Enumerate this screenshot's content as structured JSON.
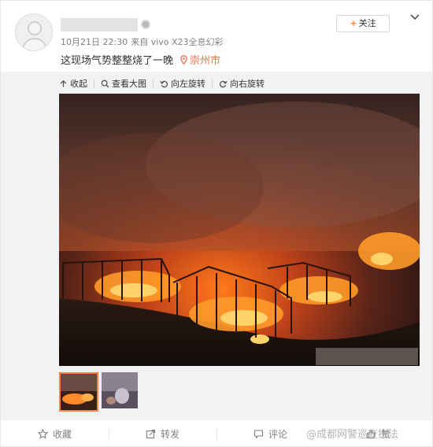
{
  "post": {
    "time": "10月21日 22:30",
    "source": "来自 vivo X23全息幻彩",
    "text": "这现场气势整整烧了一晚",
    "location": "崇州市",
    "follow_label": "关注",
    "follow_plus": "+"
  },
  "toolbar": {
    "collapse": "收起",
    "view_large": "查看大图",
    "rotate_left": "向左旋转",
    "rotate_right": "向右旋转"
  },
  "thumbnails": [
    {
      "label": "thumbnail-1",
      "active": true
    },
    {
      "label": "thumbnail-2",
      "active": false
    }
  ],
  "actions": {
    "favorite": "收藏",
    "repost": "转发",
    "comment": "评论",
    "like": "赞"
  },
  "watermark": "@成都网警巡查执法",
  "colors": {
    "accent": "#ff8140",
    "location": "#eb7350",
    "muted": "#808080",
    "panel": "#f2f2f5"
  },
  "icons": [
    "avatar-placeholder",
    "vip-icon",
    "location-pin-icon",
    "chevron-down-icon",
    "collapse-icon",
    "magnifier-icon",
    "rotate-left-icon",
    "rotate-right-icon",
    "star-icon",
    "repost-icon",
    "comment-icon",
    "thumb-up-icon"
  ]
}
